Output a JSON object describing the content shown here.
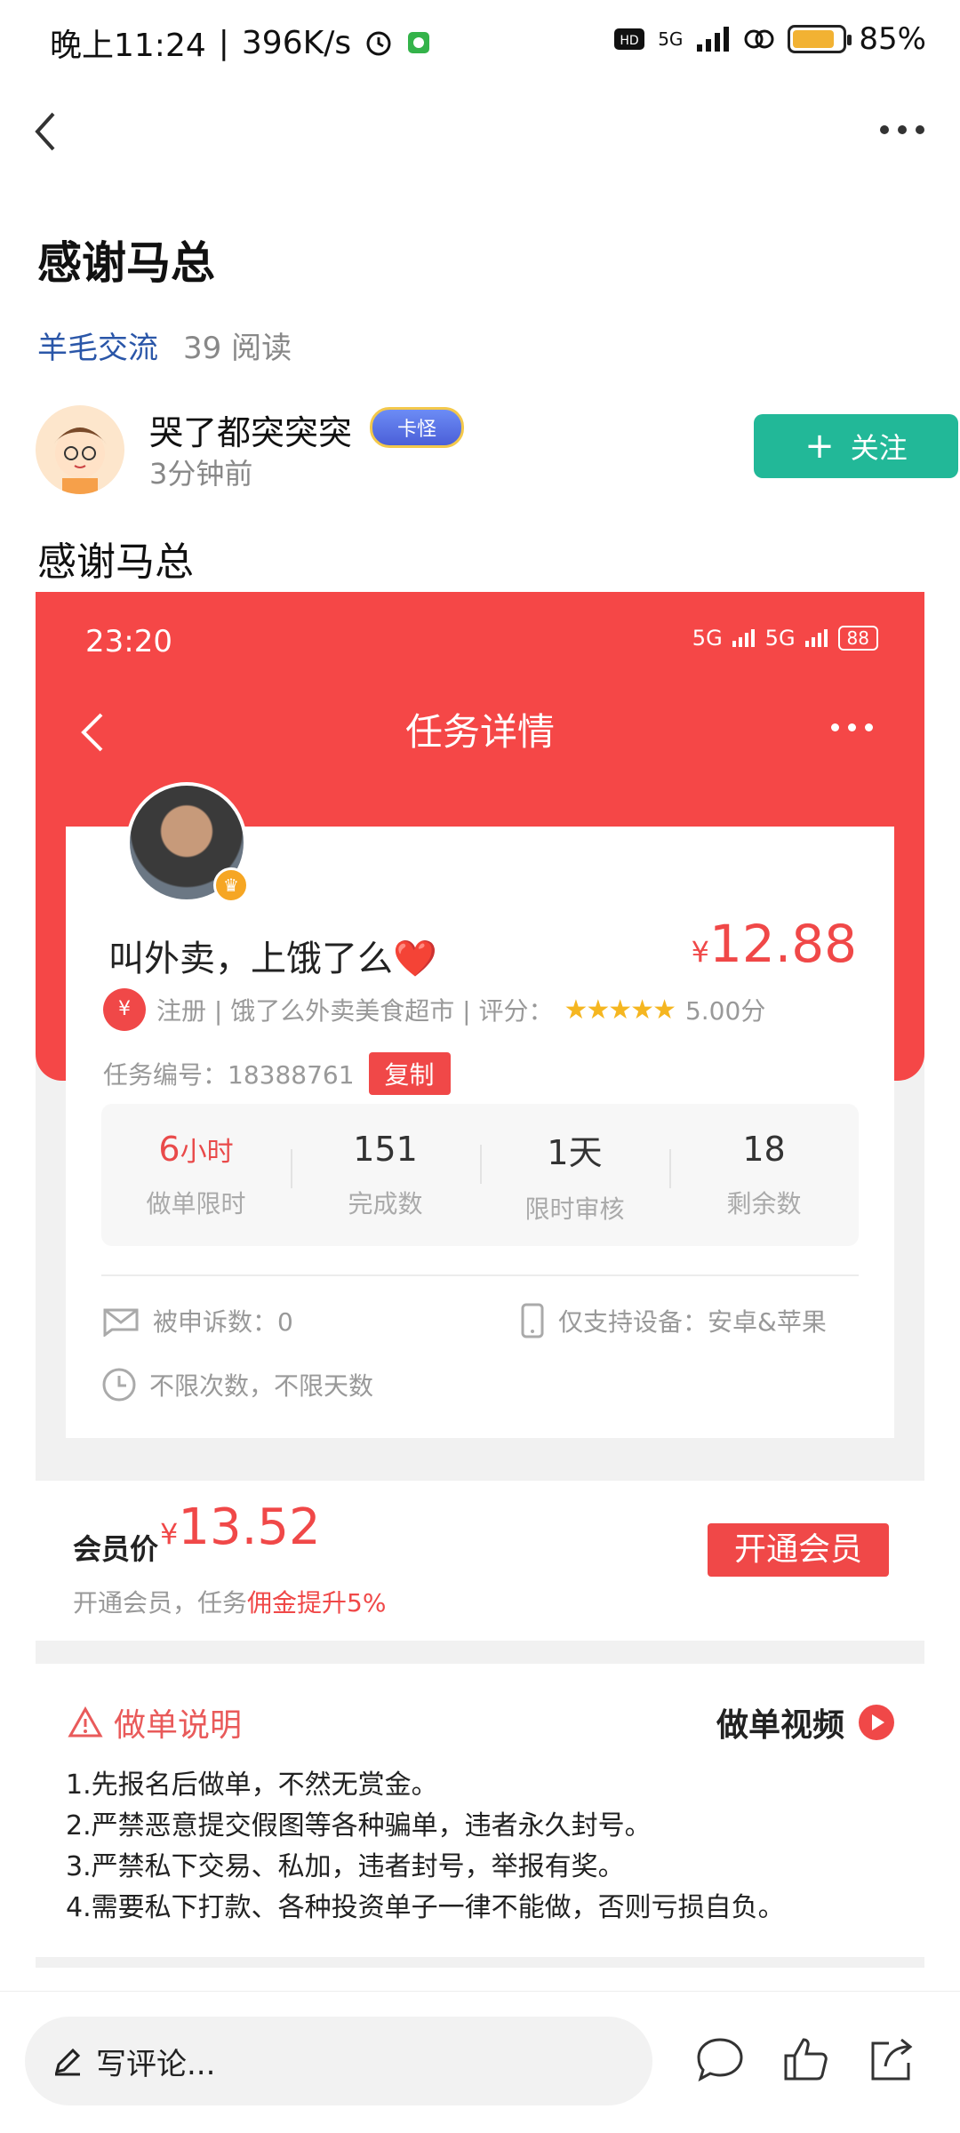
{
  "status_bar": {
    "time": "晚上11:24",
    "speed": "396K/s",
    "network": "5G",
    "battery_percent": "85%",
    "battery_level": 0.85
  },
  "post": {
    "title": "感谢马总",
    "category": "羊毛交流",
    "reads": "39 阅读",
    "body": "感谢马总"
  },
  "author": {
    "name": "哭了都突突突",
    "badge": "卡怪",
    "time": "3分钟前",
    "follow_label": "关注"
  },
  "screenshot": {
    "time": "23:20",
    "signal1": "5G",
    "signal2": "5G",
    "battery": "88",
    "nav_title": "任务详情",
    "task": {
      "title": "叫外卖，上饿了么❤️",
      "price": "12.88",
      "currency": "¥",
      "tags": "注册 | 饿了么外卖美食超市 | 评分：",
      "stars": "★★★★★",
      "rating": "5.00分",
      "number_label": "任务编号：18388761",
      "copy_label": "复制"
    },
    "stats": [
      {
        "value": "6",
        "unit": "小时",
        "label": "做单限时"
      },
      {
        "value": "151",
        "label": "完成数"
      },
      {
        "value": "1天",
        "label": "限时审核"
      },
      {
        "value": "18",
        "label": "剩余数"
      }
    ],
    "complaints": "被申诉数：0",
    "devices": "仅支持设备：安卓&苹果",
    "limits": "不限次数，不限天数",
    "vip": {
      "label": "会员价",
      "price": "13.52",
      "sub_prefix": "开通会员，任务",
      "sub_highlight": "佣金提升5%",
      "button": "开通会员"
    },
    "instructions": {
      "title": "做单说明",
      "video": "做单视频",
      "rules": [
        "1.先报名后做单，不然无赏金。",
        "2.严禁恶意提交假图等各种骗单，违者永久封号。",
        "3.严禁私下交易、私加，违者封号，举报有奖。",
        "4.需要私下打款、各种投资单子一律不能做，否则亏损自负。"
      ]
    }
  },
  "bottom_bar": {
    "comment_placeholder": "写评论..."
  },
  "colors": {
    "accent_green": "#22b898",
    "task_red": "#f54747",
    "link_blue": "#2a56a8"
  }
}
